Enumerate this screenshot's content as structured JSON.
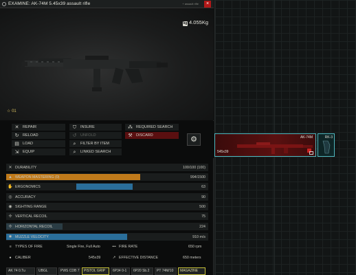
{
  "window": {
    "title": "EXAMINE: AK-74M 5.45x39 assault rifle",
    "alt_hint": "+ assault rifle",
    "close_glyph": "×"
  },
  "item": {
    "weight": "4.055Kg",
    "weight_glyph": "kg",
    "rating_prefix": "☆",
    "rating": "01"
  },
  "actions": [
    {
      "label": "REPAIR",
      "icon": "wrench-icon",
      "glyph": "✕",
      "enabled": true
    },
    {
      "label": "INSURE",
      "icon": "shield-icon",
      "glyph": "⛉",
      "enabled": true
    },
    {
      "label": "REQUIRED SEARCH",
      "icon": "search-group-icon",
      "glyph": "⁂",
      "enabled": true
    },
    {
      "label": "RELOAD",
      "icon": "reload-icon",
      "glyph": "↻",
      "enabled": true
    },
    {
      "label": "UNFOLD",
      "icon": "unfold-icon",
      "glyph": "↺",
      "enabled": false
    },
    {
      "label": "DISCARD",
      "icon": "discard-icon",
      "glyph": "⚒",
      "enabled": true
    },
    {
      "label": "LOAD",
      "icon": "load-icon",
      "glyph": "▤",
      "enabled": true
    },
    {
      "label": "FILTER BY ITEM",
      "icon": "filter-icon",
      "glyph": "⌕",
      "enabled": true
    },
    {
      "label": "EQUIP",
      "icon": "equip-icon",
      "glyph": "⇲",
      "enabled": true
    },
    {
      "label": "LINKED SEARCH",
      "icon": "linked-search-icon",
      "glyph": "⌕",
      "enabled": true
    }
  ],
  "settings_glyph": "⚙",
  "stats": [
    {
      "key": "durability",
      "label": "DURABILITY",
      "value": "100/100 (100)",
      "icon": "durability-icon",
      "glyph": "✕",
      "bar": 0
    },
    {
      "key": "mastering",
      "label": "WEAPON MASTERING (0)",
      "value": "994/1500",
      "icon": "mastering-icon",
      "glyph": "▲",
      "bar": 0.663,
      "bar_color": "#c07a1a"
    },
    {
      "key": "ergonomics",
      "label": "ERGONOMICS",
      "value": "63",
      "icon": "ergonomics-icon",
      "glyph": "✋",
      "bar": 0.63,
      "bar_color": "#2a6e9a"
    },
    {
      "key": "accuracy",
      "label": "ACCURACY",
      "value": "90",
      "icon": "accuracy-icon",
      "glyph": "◎",
      "bar": 0
    },
    {
      "key": "sighting",
      "label": "SIGHTING RANGE",
      "value": "500",
      "icon": "sighting-icon",
      "glyph": "◉",
      "bar": 0
    },
    {
      "key": "vrecoil",
      "label": "VERTICAL RECOIL",
      "value": "75",
      "icon": "vrecoil-icon",
      "glyph": "✢",
      "bar": 0
    },
    {
      "key": "hrecoil",
      "label": "HORIZONTAL RECOIL",
      "value": "224",
      "icon": "hrecoil-icon",
      "glyph": "✢",
      "bar": 0.28,
      "bar_color": "#2a3c44"
    },
    {
      "key": "velocity",
      "label": "MUZZLE VELOCITY",
      "value": "910 m/s",
      "icon": "velocity-icon",
      "glyph": "✸",
      "bar": 0.6,
      "bar_color": "#2a6e9a"
    }
  ],
  "info": {
    "fire_types_label": "TYPES OF FIRE",
    "fire_types_value": "Single Fire, Full Auto",
    "fire_rate_label": "FIRE RATE",
    "fire_rate_value": "650 rpm",
    "caliber_label": "CALIBER",
    "caliber_value": "545x39",
    "eff_dist_label": "EFFECTIVE DISTANCE",
    "eff_dist_value": "650 meters"
  },
  "mods": [
    {
      "label": "AK 74 0.Tu",
      "highlight": false
    },
    {
      "label": "UBGL",
      "highlight": false
    },
    {
      "label": "PWS CDB 7",
      "highlight": false
    },
    {
      "label": "PISTOL GRIP",
      "highlight": true
    },
    {
      "label": "6P34 0-1",
      "highlight": false
    },
    {
      "label": "6P20 Sb.2",
      "highlight": false
    },
    {
      "label": "PT 74M/10",
      "highlight": false
    },
    {
      "label": "MAGAZINE",
      "highlight": true
    }
  ],
  "inventory": {
    "rifle_name": "AK-74M",
    "rifle_caliber": "545x39",
    "optic_name": "RK-3"
  },
  "colors": {
    "accent_cyan": "#4fb9c0",
    "danger_red": "#5a0f10",
    "mastering_orange": "#c07a1a",
    "bar_blue": "#2a6e9a"
  }
}
